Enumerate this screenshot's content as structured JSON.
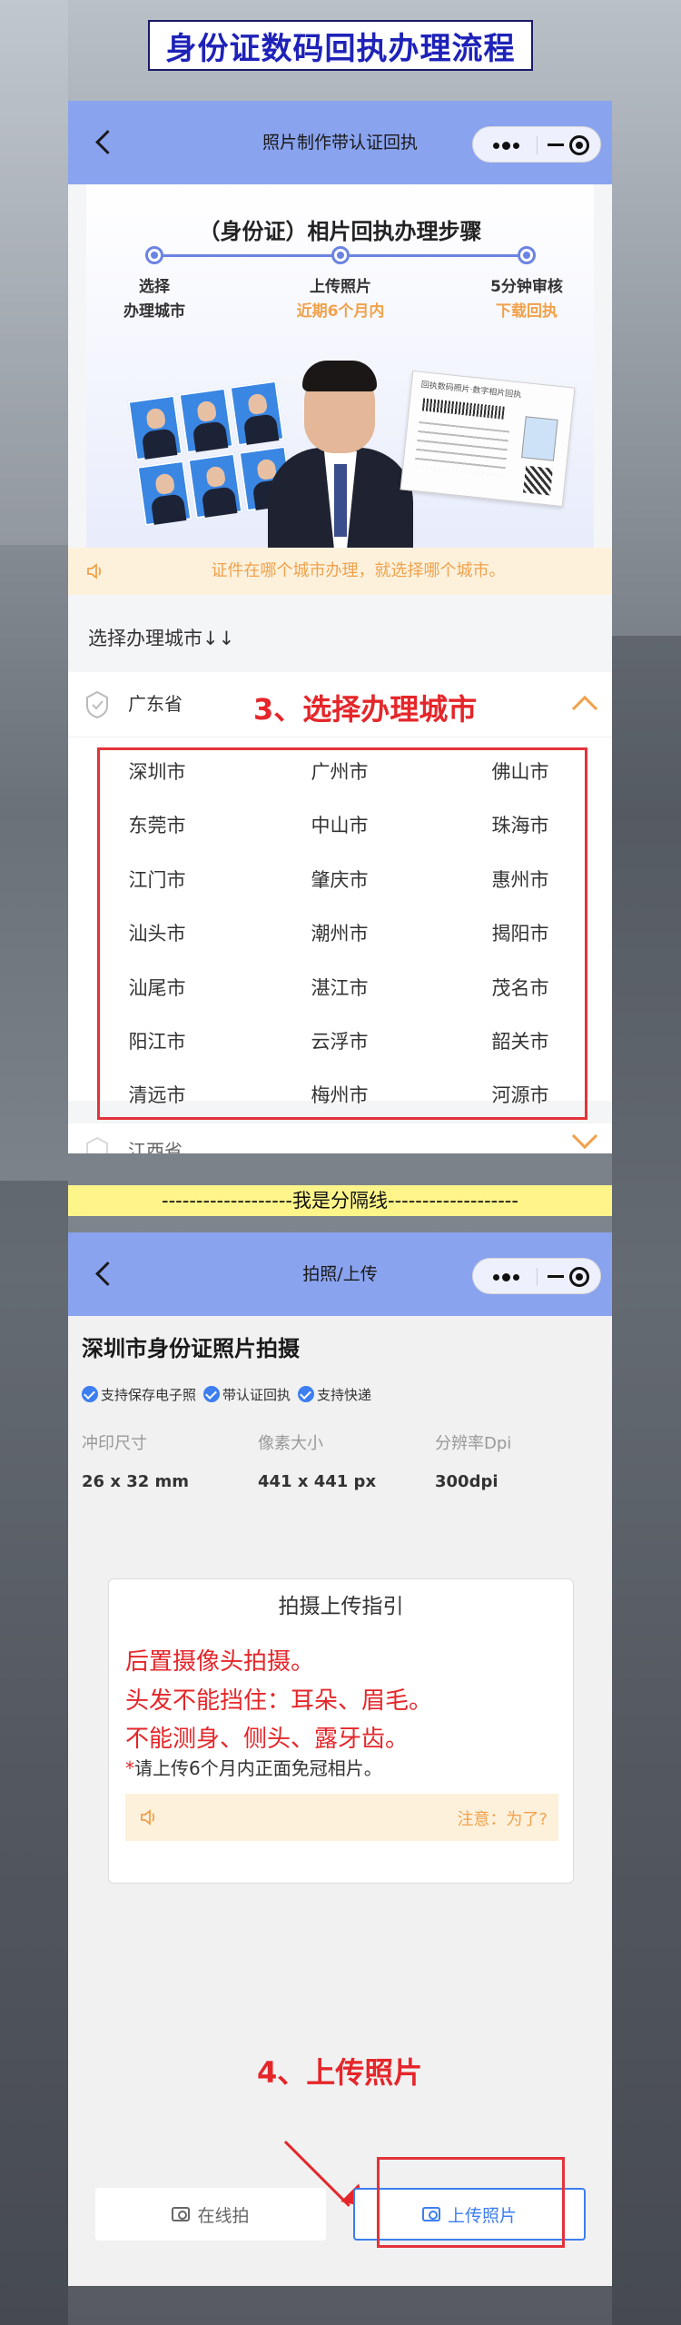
{
  "page_title": "身份证数码回执办理流程",
  "phone1": {
    "nav_title": "照片制作带认证回执",
    "banner": {
      "steps_title": "（身份证）相片回执办理步骤",
      "steps": [
        {
          "line1": "选择",
          "line2": "办理城市",
          "line2_color": "dark"
        },
        {
          "line1": "上传照片",
          "line2": "近期6个月内",
          "line2_color": "orange"
        },
        {
          "line1": "5分钟审核",
          "line2": "下载回执",
          "line2_color": "orange"
        }
      ],
      "receipt_caption": "回执数码照片·数字相片回执"
    },
    "notice": "证件在哪个城市办理，就选择哪个城市。",
    "city_heading": "选择办理城市↓↓",
    "province": "广东省",
    "callout": "3、选择办理城市",
    "cities": [
      [
        "深圳市",
        "广州市",
        "佛山市"
      ],
      [
        "东莞市",
        "中山市",
        "珠海市"
      ],
      [
        "江门市",
        "肇庆市",
        "惠州市"
      ],
      [
        "汕头市",
        "潮州市",
        "揭阳市"
      ],
      [
        "汕尾市",
        "湛江市",
        "茂名市"
      ],
      [
        "阳江市",
        "云浮市",
        "韶关市"
      ],
      [
        "清远市",
        "梅州市",
        "河源市"
      ]
    ],
    "next_province": "江西省"
  },
  "divider": "-------------------我是分隔线-------------------",
  "phone2": {
    "nav_title": "拍照/上传",
    "info_title": "深圳市身份证照片拍摄",
    "badges": [
      "支持保存电子照",
      "带认证回执",
      "支持快递"
    ],
    "specs": [
      {
        "label": "冲印尺寸",
        "value": "26 x 32 mm"
      },
      {
        "label": "像素大小",
        "value": "441 x 441 px"
      },
      {
        "label": "分辨率Dpi",
        "value": "300dpi"
      }
    ],
    "guide": {
      "title": "拍摄上传指引",
      "lines": [
        "后置摄像头拍摄。",
        "头发不能挡住：耳朵、眉毛。",
        "不能测身、侧头、露牙齿。"
      ],
      "note_star": "*",
      "note": "请上传6个月内正面免冠相片。",
      "notice": "注意：为了?"
    },
    "callout": "4、上传照片",
    "btn_online": "在线拍",
    "btn_upload": "上传照片"
  },
  "colors": {
    "nav_blue": "#8aa3ee",
    "accent_orange": "#f1a14b",
    "callout_red": "#e5262a",
    "primary_blue": "#3d7ef0",
    "title_blue": "#1e22b8"
  }
}
